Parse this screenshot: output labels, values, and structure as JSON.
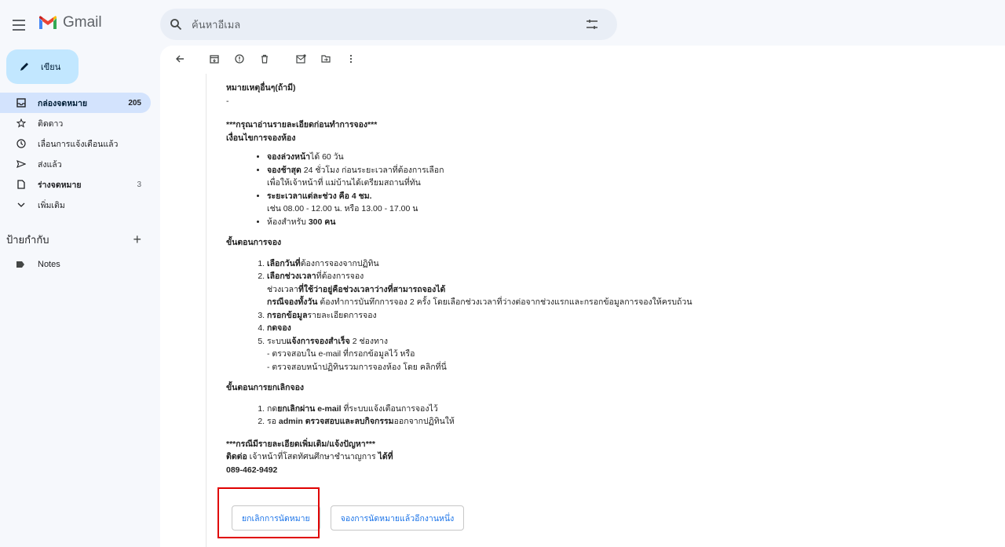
{
  "app": {
    "name": "Gmail"
  },
  "search": {
    "placeholder": "ค้นหาอีเมล"
  },
  "compose": {
    "label": "เขียน"
  },
  "sidebar": {
    "items": [
      {
        "label": "กล่องจดหมาย",
        "count": "205",
        "icon": "inbox-icon",
        "active": true
      },
      {
        "label": "ติดดาว",
        "count": "",
        "icon": "star-icon"
      },
      {
        "label": "เลื่อนการแจ้งเตือนแล้ว",
        "count": "",
        "icon": "clock-icon"
      },
      {
        "label": "ส่งแล้ว",
        "count": "",
        "icon": "send-icon"
      },
      {
        "label": "ร่างจดหมาย",
        "count": "3",
        "icon": "draft-icon",
        "bold": true
      },
      {
        "label": "เพิ่มเติม",
        "count": "",
        "icon": "chevron-down-icon"
      }
    ],
    "labels_title": "ป้ายกำกับ",
    "labels": [
      {
        "label": "Notes",
        "icon": "label-icon"
      }
    ]
  },
  "toolbar": {
    "icons": [
      "back-arrow-icon",
      "archive-icon",
      "report-spam-icon",
      "delete-icon",
      "mark-unread-icon",
      "move-to-icon",
      "more-vert-icon"
    ]
  },
  "email": {
    "other_reason_title": "หมายเหตุอื่นๆ(ถ้ามี)",
    "other_reason_value": "-",
    "notice": "***กรุณาอ่านรายละเอียดก่อนทำการจอง***",
    "conditions_title": "เงื่อนไขการจองห้อง",
    "conditions": {
      "c1_bold": "จองล่วงหน้า",
      "c1_rest": "ได้ 60 วัน",
      "c2_bold": "จองช้าสุด",
      "c2_rest": " 24 ชั่วโมง ก่อนระยะเวลาที่ต้องการเลือก",
      "c2_line2": "เพื่อให้เจ้าหน้าที่ แม่บ้านได้เตรียมสถานที่ทัน",
      "c3_bold1": "ระยะเวลาแต่ละช่วง",
      "c3_bold2": " คือ 4 ชม.",
      "c3_line2": "เช่น 08.00 - 12.00 น. หรือ 13.00 - 17.00 น",
      "c4_rest": "ห้องสำหรับ ",
      "c4_bold": "300 คน"
    },
    "steps_title": "ขั้นตอนการจอง",
    "steps": {
      "s1_bold": "เลือกวันที่",
      "s1_rest": "ต้องการจองจากปฏิทิน",
      "s2_bold": "เลือกช่วงเวลา",
      "s2_rest": "ที่ต้องการจอง",
      "s2_line2_a": "ช่วงเวลา",
      "s2_line2_b": "ที่ใช้ว่าอยู่คือช่วงเวลาว่างที่สามารถจองได้",
      "s2_line3_bold": "กรณีจองทั้งวัน",
      "s2_line3_rest": " ต้องทำการบันทึกการจอง 2 ครั้ง โดยเลือกช่วงเวลาที่ว่างต่อจากช่วงแรกและกรอกข้อมูลการจองให้ครบถ้วน",
      "s3_bold": "กรอกข้อมูล",
      "s3_rest": "รายละเอียดการจอง",
      "s4_bold": "กดจอง",
      "s5_rest": "ระบบ",
      "s5_bold": "แจ้งการจองสำเร็จ",
      "s5_rest2": " 2 ช่องทาง",
      "s5_line2": "- ตรวจสอบใน e-mail ที่กรอกข้อมูลไว้ หรือ",
      "s5_line3": "- ตรวจสอบหน้าปฏิทินรวมการจองห้อง โดย คลิกที่นี่"
    },
    "cancel_title": "ขั้นตอนการยกเลิกจอง",
    "cancel": {
      "k1_rest": "กด",
      "k1_bold": "ยกเลิกผ่าน e-mail",
      "k1_rest2": " ที่ระบบแจ้งเตือนการจองไว้",
      "k2_rest": "รอ ",
      "k2_bold": "admin ตรวจสอบและลบกิจกรรม",
      "k2_rest2": "ออกจากปฏิทินให้"
    },
    "contact_notice": "***กรณีมีรายละเอียดเพิ่มเติม/แจ้งปัญหา***",
    "contact_bold1": "ติดต่อ",
    "contact_rest": " เจ้าหน้าที่โสตทัศนศึกษาชำนาญการ ",
    "contact_bold2": "ได้ที่",
    "phone": "089-462-9492",
    "buttons": {
      "cancel_label": "ยกเลิกการนัดหมาย",
      "book_again_label": "จองการนัดหมายแล้วอีกงานหนึ่ง"
    }
  },
  "colors": {
    "accent": "#1a73e8",
    "compose_bg": "#c2e7ff",
    "active_nav": "#d3e3fd",
    "highlight": "#e00000"
  }
}
